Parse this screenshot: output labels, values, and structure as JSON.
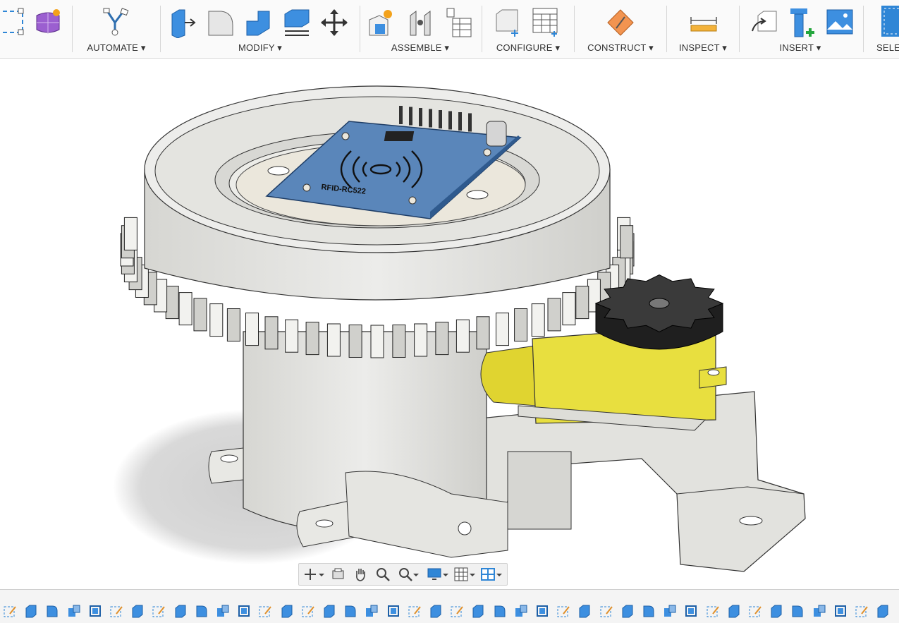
{
  "ribbon": {
    "groups": [
      {
        "id": "create",
        "label": ""
      },
      {
        "id": "automate",
        "label": "AUTOMATE ▾"
      },
      {
        "id": "modify",
        "label": "MODIFY ▾"
      },
      {
        "id": "assemble",
        "label": "ASSEMBLE ▾"
      },
      {
        "id": "configure",
        "label": "CONFIGURE ▾"
      },
      {
        "id": "construct",
        "label": "CONSTRUCT ▾"
      },
      {
        "id": "inspect",
        "label": "INSPECT ▾"
      },
      {
        "id": "insert",
        "label": "INSERT ▾"
      },
      {
        "id": "select",
        "label": "SELE"
      }
    ]
  },
  "viewport": {
    "model_label": "RFID-RC522"
  },
  "colors": {
    "accent_blue": "#2f86d6",
    "pcb_blue": "#4f7fb5",
    "gear_black": "#2b2b2b",
    "motor_yellow": "#e6dd3c",
    "body_gray": "#e3e3df"
  },
  "navbar": {
    "icons": [
      "orbit-icon",
      "look-at-icon",
      "pan-icon",
      "zoom-icon",
      "fit-icon",
      "display-settings-icon",
      "grid-icon",
      "viewports-icon"
    ]
  },
  "timeline": {
    "item_count": 42
  }
}
